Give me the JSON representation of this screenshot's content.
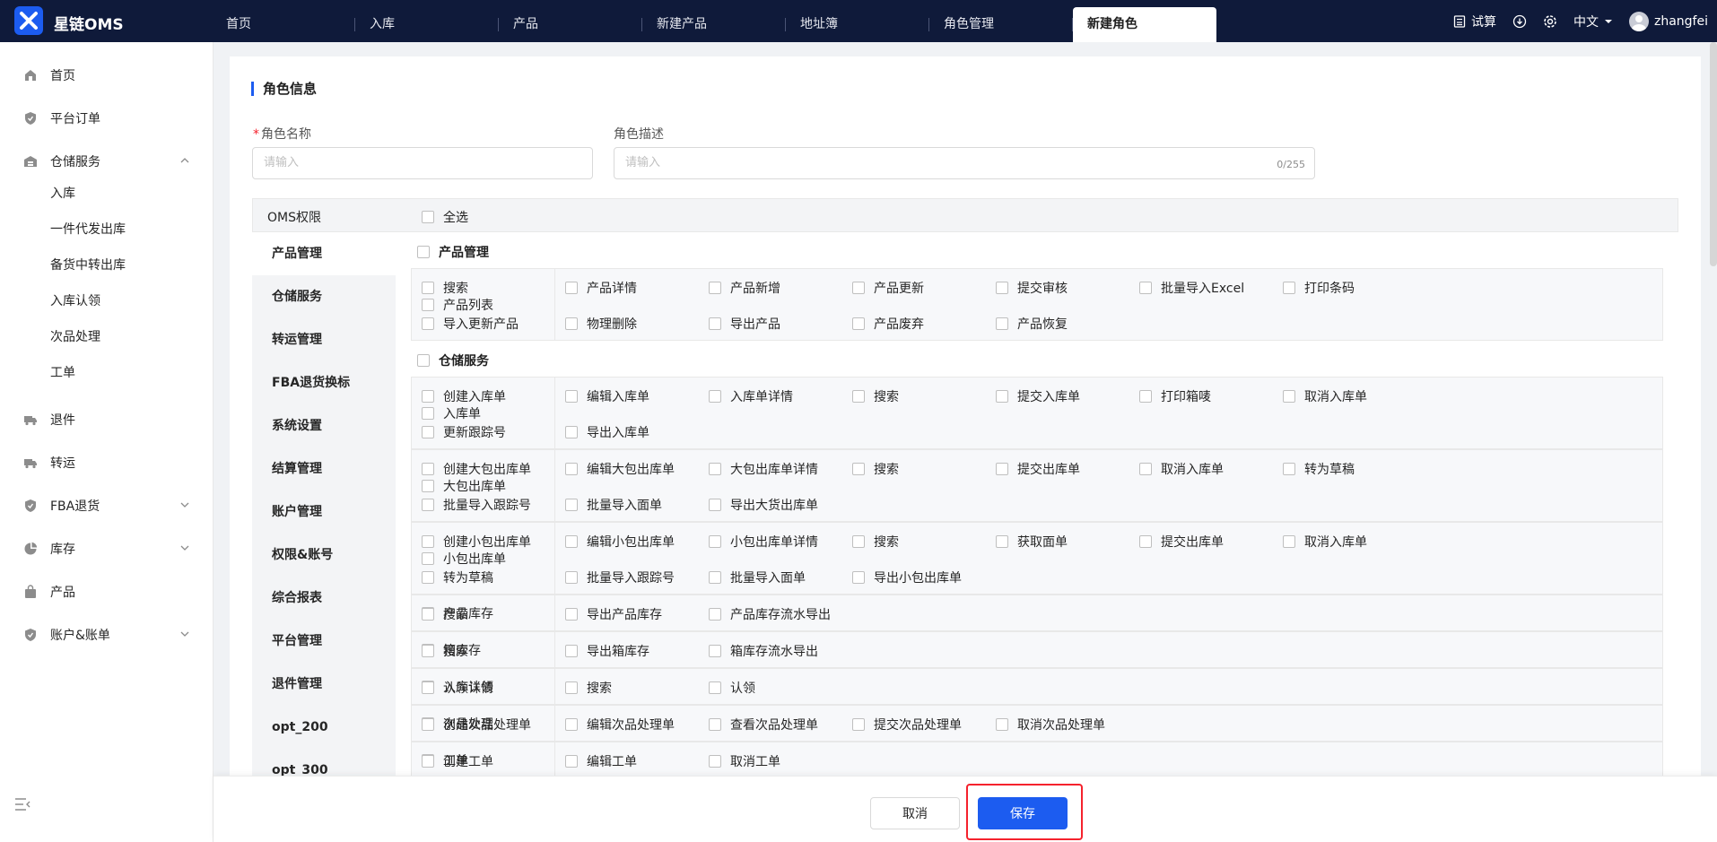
{
  "app": {
    "title": "星链OMS",
    "brand_color": "#1c5cf0",
    "header_bg": "#0f1a3a"
  },
  "tabs": [
    {
      "label": "首页"
    },
    {
      "label": "入库"
    },
    {
      "label": "产品"
    },
    {
      "label": "新建产品"
    },
    {
      "label": "地址簿"
    },
    {
      "label": "角色管理"
    },
    {
      "label": "新建角色",
      "active": true
    }
  ],
  "header_right": {
    "calc": "试算",
    "lang": "中文",
    "user": "zhangfei"
  },
  "sidebar": {
    "items": [
      {
        "label": "首页",
        "icon": "home-icon"
      },
      {
        "label": "平台订单",
        "icon": "shield-icon"
      },
      {
        "label": "仓储服务",
        "icon": "warehouse-icon",
        "expanded": true
      },
      {
        "label": "退件",
        "icon": "truck-icon"
      },
      {
        "label": "转运",
        "icon": "truck-icon"
      },
      {
        "label": "FBA退货",
        "icon": "shield-icon"
      },
      {
        "label": "库存",
        "icon": "pie-chart-icon"
      },
      {
        "label": "产品",
        "icon": "bag-icon"
      },
      {
        "label": "账户&账单",
        "icon": "shield-icon"
      }
    ],
    "sub_items": [
      "入库",
      "一件代发出库",
      "备货中转出库",
      "入库认领",
      "次品处理",
      "工单"
    ]
  },
  "form": {
    "section_title": "角色信息",
    "name_label": "角色名称",
    "name_placeholder": "请输入",
    "desc_label": "角色描述",
    "desc_placeholder": "请输入",
    "desc_counter": "0/255"
  },
  "perm": {
    "header_title": "OMS权限",
    "select_all": "全选",
    "categories": [
      "产品管理",
      "仓储服务",
      "转运管理",
      "FBA退货换标",
      "系统设置",
      "结算管理",
      "账户管理",
      "权限&账号",
      "综合报表",
      "平台管理",
      "退件管理",
      "opt_200",
      "opt_300"
    ],
    "groups": [
      {
        "title": "产品管理",
        "modules": [
          {
            "name": "产品列表",
            "options": [
              "搜索",
              "产品详情",
              "产品新增",
              "产品更新",
              "提交审核",
              "批量导入Excel",
              "打印条码",
              "导入更新产品",
              "物理删除",
              "导出产品",
              "产品废弃",
              "产品恢复"
            ]
          }
        ]
      },
      {
        "title": "仓储服务",
        "modules": [
          {
            "name": "入库单",
            "options": [
              "创建入库单",
              "编辑入库单",
              "入库单详情",
              "搜索",
              "提交入库单",
              "打印箱唛",
              "取消入库单",
              "更新跟踪号",
              "导出入库单"
            ]
          },
          {
            "name": "大包出库单",
            "options": [
              "创建大包出库单",
              "编辑大包出库单",
              "大包出库单详情",
              "搜索",
              "提交出库单",
              "取消入库单",
              "转为草稿",
              "批量导入跟踪号",
              "批量导入面单",
              "导出大货出库单"
            ]
          },
          {
            "name": "小包出库单",
            "options": [
              "创建小包出库单",
              "编辑小包出库单",
              "小包出库单详情",
              "搜索",
              "获取面单",
              "提交出库单",
              "取消入库单",
              "转为草稿",
              "批量导入跟踪号",
              "批量导入面单",
              "导出小包出库单"
            ]
          },
          {
            "name": "产品库存",
            "options": [
              "搜索",
              "导出产品库存",
              "产品库存流水导出"
            ]
          },
          {
            "name": "箱库存",
            "options": [
              "搜索",
              "导出箱库存",
              "箱库存流水导出"
            ]
          },
          {
            "name": "入库认领",
            "options": [
              "认领详情",
              "搜索",
              "认领"
            ]
          },
          {
            "name": "次品处理",
            "options": [
              "创建次品处理单",
              "编辑次品处理单",
              "查看次品处理单",
              "提交次品处理单",
              "取消次品处理单"
            ]
          },
          {
            "name": "工单",
            "options": [
              "创建工单",
              "编辑工单",
              "取消工单"
            ]
          }
        ]
      }
    ]
  },
  "footer": {
    "cancel": "取消",
    "save": "保存"
  }
}
